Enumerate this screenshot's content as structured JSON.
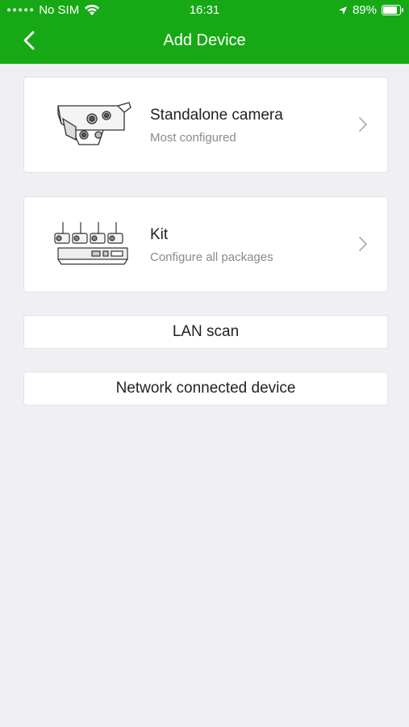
{
  "status_bar": {
    "carrier": "No SIM",
    "time": "16:31",
    "battery": "89%",
    "battery_level": 0.89
  },
  "nav": {
    "title": "Add Device",
    "back_icon": "chevron-left-icon"
  },
  "options": [
    {
      "title": "Standalone camera",
      "subtitle": "Most configured",
      "icon": "bullet-camera-icon"
    },
    {
      "title": "Kit",
      "subtitle": "Configure all packages",
      "icon": "nvr-kit-icon"
    }
  ],
  "buttons": {
    "lan_scan": "LAN scan",
    "network_device": "Network connected device"
  },
  "colors": {
    "accent": "#17a915",
    "background": "#efeff4"
  }
}
